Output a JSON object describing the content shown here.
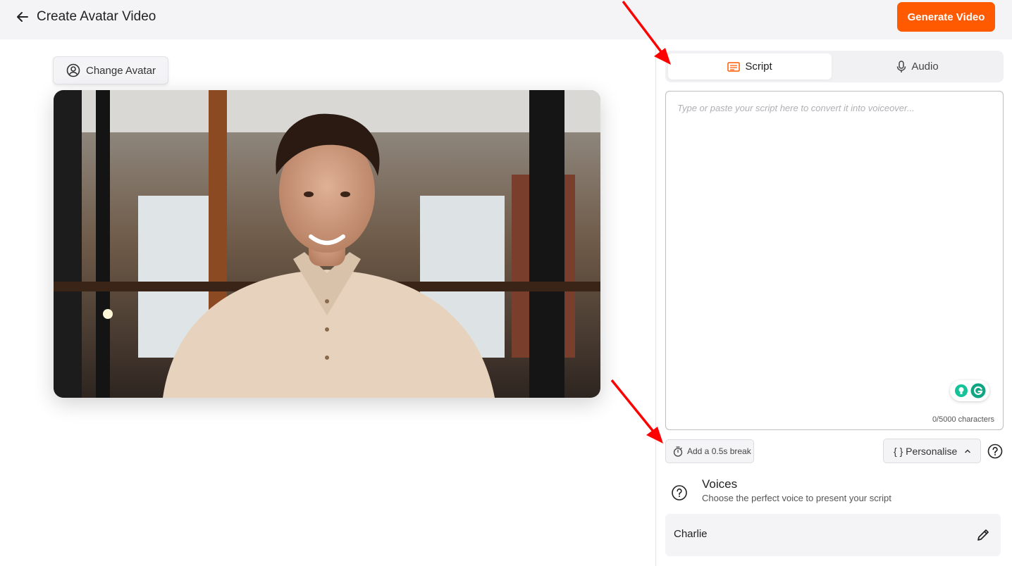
{
  "header": {
    "title": "Create Avatar Video",
    "generate_label": "Generate Video",
    "accent": "#ff5a00"
  },
  "avatar": {
    "change_label": "Change Avatar"
  },
  "tabs": [
    {
      "label": "Script",
      "icon": "script-icon",
      "active": true
    },
    {
      "label": "Audio",
      "icon": "microphone-icon",
      "active": false
    }
  ],
  "script": {
    "placeholder": "Type or paste your script here to convert it into voiceover...",
    "value": "",
    "char_count": "0/5000 characters"
  },
  "tools": {
    "break_label": "Add a 0.5s break",
    "personalise_label": "{ } Personalise"
  },
  "voices": {
    "title": "Voices",
    "subtitle": "Choose the perfect voice to present your script",
    "selected": "Charlie"
  },
  "annotations": {
    "arrow_color": "#ff0000"
  }
}
